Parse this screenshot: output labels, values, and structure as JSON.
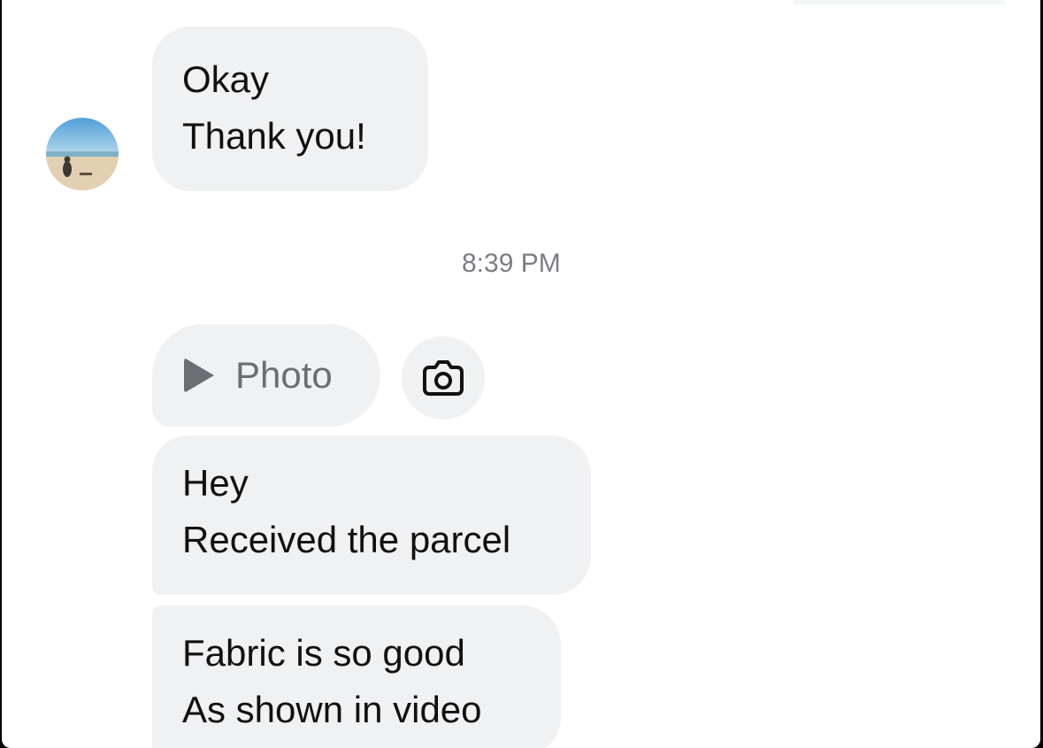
{
  "messages": [
    {
      "lines": [
        "Okay",
        "Thank you!"
      ]
    }
  ],
  "timestamp": "8:39 PM",
  "attachment": {
    "label": "Photo",
    "icon": "play-icon",
    "action_icon": "camera-icon"
  },
  "later_messages": [
    {
      "lines": [
        "Hey",
        "Received the parcel"
      ]
    },
    {
      "lines": [
        "Fabric is so good",
        "As shown in video"
      ]
    }
  ],
  "colors": {
    "bubble": "#f0f1f3",
    "text": "#111111",
    "muted": "#7a7d82",
    "background": "#ffffff"
  }
}
